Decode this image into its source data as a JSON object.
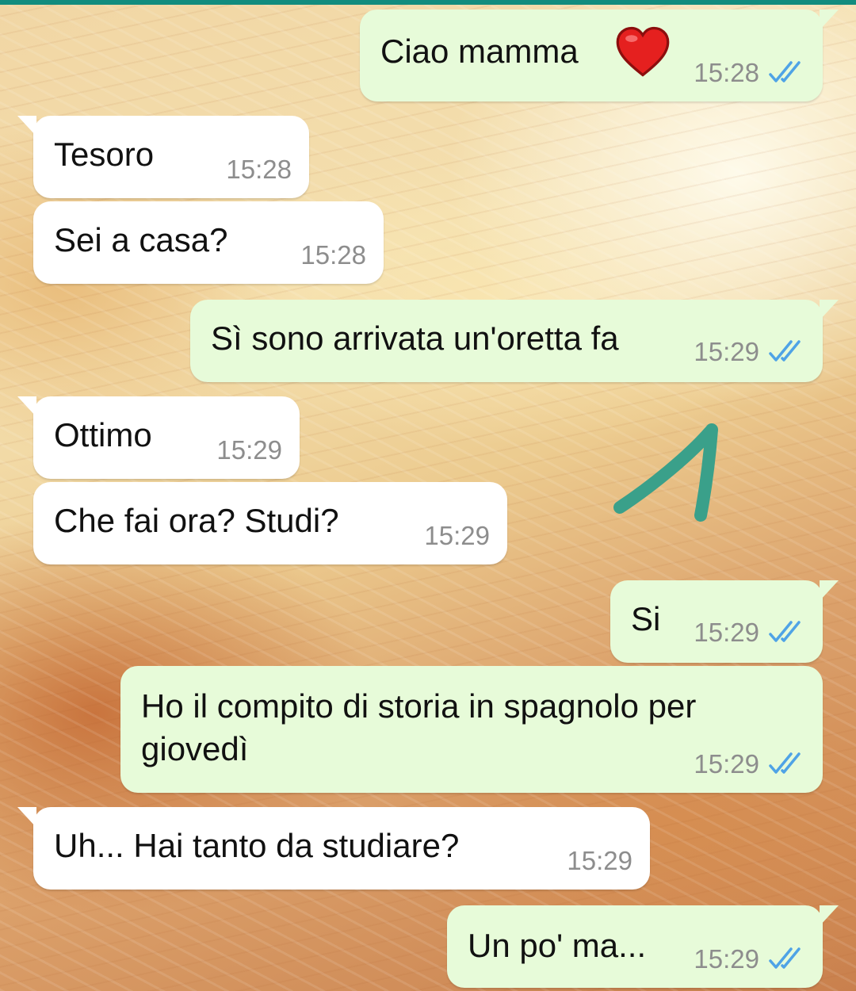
{
  "chat": {
    "messages": [
      {
        "direction": "out",
        "text": "Ciao mamma",
        "emoji": "red-heart",
        "time": "15:28",
        "status": "read"
      },
      {
        "direction": "in",
        "text": "Tesoro",
        "time": "15:28"
      },
      {
        "direction": "in",
        "text": "Sei a casa?",
        "time": "15:28"
      },
      {
        "direction": "out",
        "text": "Sì sono arrivata un'oretta fa",
        "time": "15:29",
        "status": "read"
      },
      {
        "direction": "in",
        "text": "Ottimo",
        "time": "15:29"
      },
      {
        "direction": "in",
        "text": "Che fai ora? Studi?",
        "time": "15:29"
      },
      {
        "direction": "out",
        "text": "Si",
        "time": "15:29",
        "status": "read"
      },
      {
        "direction": "out",
        "text": "Ho il compito di storia in spagnolo per\ngiovedì",
        "time": "15:29",
        "status": "read"
      },
      {
        "direction": "in",
        "text": "Uh... Hai tanto da studiare?",
        "time": "15:29"
      },
      {
        "direction": "out",
        "text": "Un po' ma...",
        "time": "15:29",
        "status": "read"
      }
    ]
  },
  "colors": {
    "header_accent": "#128c7e",
    "incoming_bubble": "#ffffff",
    "outgoing_bubble": "#e7fbd9",
    "read_ticks": "#4fa3e6",
    "annotation_stroke": "#3aa08a",
    "heart": "#e5201f"
  },
  "icons": {
    "read_receipt": "double-check-icon",
    "annotation": "hand-drawn-arrow-icon",
    "emoji": "red-heart-emoji"
  }
}
